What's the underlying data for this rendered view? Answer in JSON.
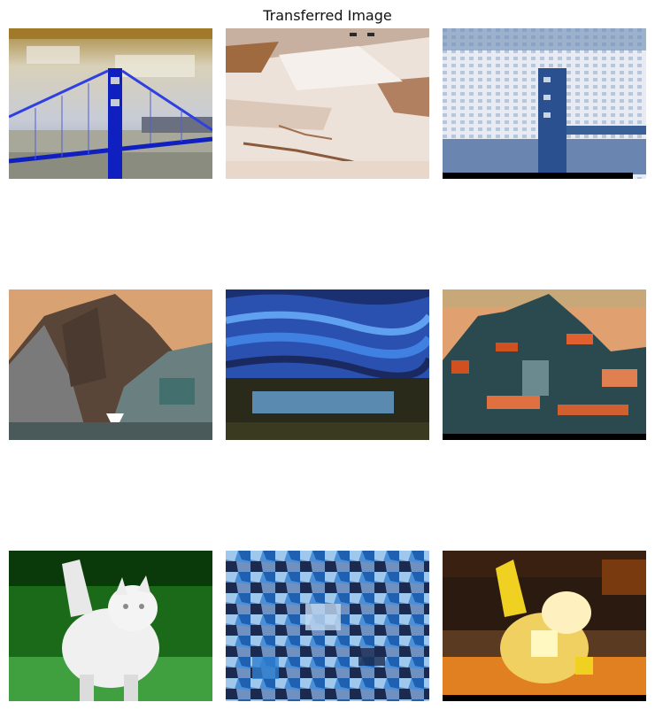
{
  "figure": {
    "title": "Transferred Image"
  },
  "grid": {
    "rows": 3,
    "cols": 3,
    "cells": [
      {
        "subject": "golden-gate-bridge",
        "style": "content",
        "palette": [
          "#e8e0c8",
          "#9a8a60",
          "#c8ccd6",
          "#1020c0",
          "#5a6a80"
        ]
      },
      {
        "subject": "sepia-sketch",
        "style": "style",
        "palette": [
          "#f2ebe6",
          "#d4c0b0",
          "#a07050",
          "#7a4a2a"
        ]
      },
      {
        "subject": "bridge-transferred",
        "style": "result",
        "palette": [
          "#f0f2f6",
          "#c0cce0",
          "#2a5090",
          "#6080b0",
          "#000000"
        ]
      },
      {
        "subject": "mountains",
        "style": "content",
        "palette": [
          "#d9a272",
          "#5a4638",
          "#8a8a8a",
          "#3a6a6a",
          "#ffffff"
        ]
      },
      {
        "subject": "starry-night",
        "style": "style",
        "palette": [
          "#2040a0",
          "#4080e0",
          "#1a2a50",
          "#5a8ab0",
          "#2a2a1a"
        ]
      },
      {
        "subject": "mountains-transferred",
        "style": "result",
        "palette": [
          "#e0a070",
          "#2a4a50",
          "#d05020",
          "#6a8a90",
          "#000000"
        ]
      },
      {
        "subject": "white-cat",
        "style": "content",
        "palette": [
          "#1a6a1a",
          "#40a040",
          "#f0f0f0",
          "#c8c8c8",
          "#0a3a0a"
        ]
      },
      {
        "subject": "blue-mosaic",
        "style": "style",
        "palette": [
          "#40a0e0",
          "#2060b0",
          "#a0c0e0",
          "#1a2a50",
          "#7090c0"
        ]
      },
      {
        "subject": "cat-transferred",
        "style": "result",
        "palette": [
          "#2a1a10",
          "#f0d020",
          "#e08020",
          "#fff8c0",
          "#7a3a10"
        ]
      }
    ]
  }
}
